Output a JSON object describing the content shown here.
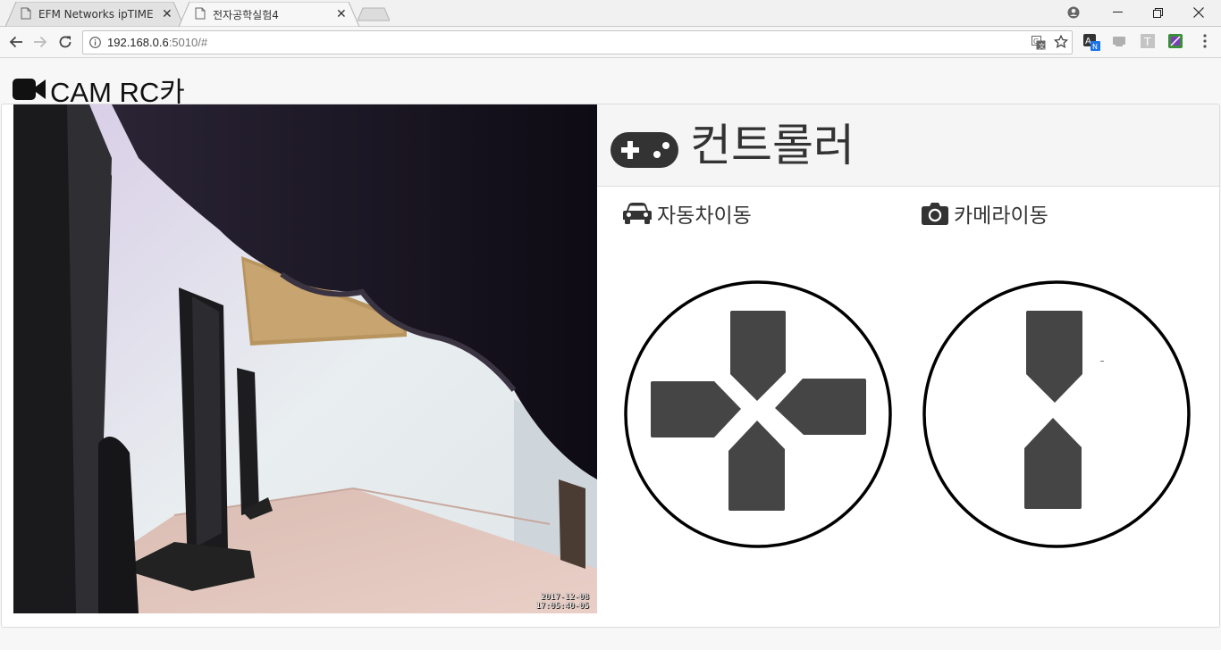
{
  "browser": {
    "tabs": [
      {
        "title": "EFM Networks ipTIME N",
        "active": false
      },
      {
        "title": "전자공학실험4",
        "active": true
      }
    ],
    "url": {
      "host": "192.168.0.6",
      "rest": ":5010/#"
    }
  },
  "page": {
    "title": "CAM RC카",
    "controller_title": "컨트롤러",
    "car_label": "자동차이동",
    "camera_label": "카메라이동"
  },
  "camera": {
    "stamp_date": "2017-12-08",
    "stamp_time": "17:05:40-05"
  },
  "icons": {
    "title": "video-camera-icon",
    "controller": "gamepad-icon",
    "car": "car-icon",
    "camera": "camera-icon"
  },
  "colors": {
    "pad": "#454545",
    "text": "#333333"
  }
}
